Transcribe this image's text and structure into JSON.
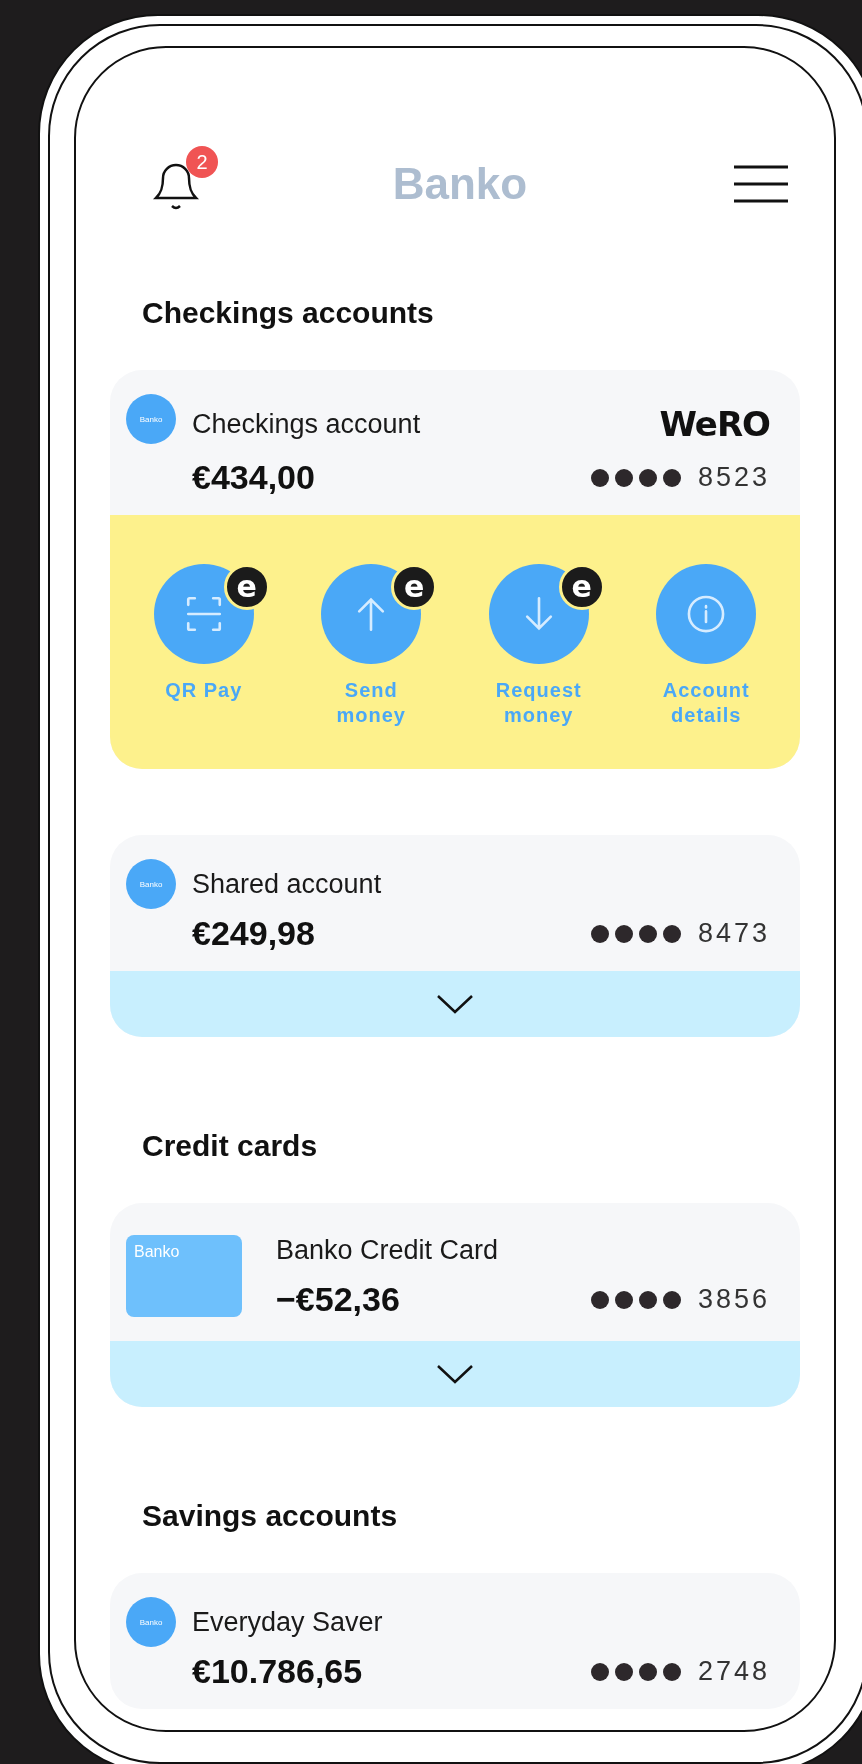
{
  "header": {
    "title": "Banko",
    "notification_count": "2"
  },
  "sections": [
    {
      "title": "Checkings accounts",
      "accounts": [
        {
          "kind": "account",
          "logo_text": "Banko",
          "name": "Checkings account",
          "balance": "€434,00",
          "last_digits": "8523",
          "brand": "WeRO",
          "actions": [
            {
              "kind": "qr",
              "label": "QR Pay",
              "badge": "e"
            },
            {
              "kind": "send",
              "label": "Send money",
              "badge": "e"
            },
            {
              "kind": "request",
              "label": "Request money",
              "badge": "e"
            },
            {
              "kind": "info",
              "label": "Account details"
            }
          ]
        },
        {
          "kind": "account",
          "logo_text": "Banko",
          "name": "Shared account",
          "balance": "€249,98",
          "last_digits": "8473",
          "expanded": false
        }
      ]
    },
    {
      "title": "Credit cards",
      "accounts": [
        {
          "kind": "card",
          "logo_text": "Banko",
          "name": "Banko Credit Card",
          "balance": "−€52,36",
          "last_digits": "3856",
          "expanded": false
        }
      ]
    },
    {
      "title": "Savings accounts",
      "accounts": [
        {
          "kind": "account",
          "logo_text": "Banko",
          "name": "Everyday Saver",
          "balance": "€10.786,65",
          "last_digits": "2748"
        }
      ]
    }
  ]
}
